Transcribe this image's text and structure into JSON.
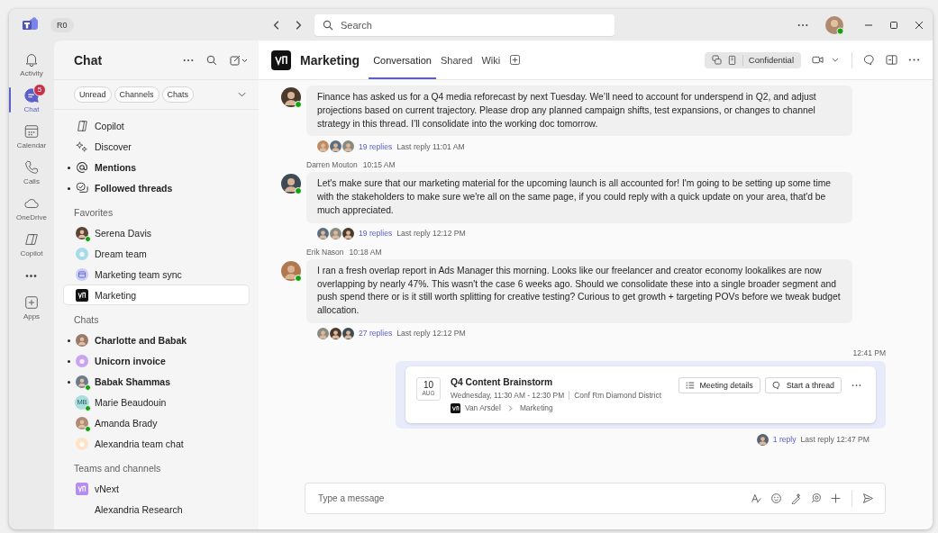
{
  "titlebar": {
    "account": "R0",
    "search": {
      "placeholder": "Search"
    }
  },
  "rail": [
    {
      "label": "Activity",
      "kind": "bell",
      "selected": false
    },
    {
      "label": "Chat",
      "kind": "chat",
      "selected": true,
      "badge": "5"
    },
    {
      "label": "Calendar",
      "kind": "calendar",
      "selected": false
    },
    {
      "label": "Calls",
      "kind": "phone",
      "selected": false
    },
    {
      "label": "OneDrive",
      "kind": "cloud",
      "selected": false
    },
    {
      "label": "Copilot",
      "kind": "copilot",
      "selected": false
    },
    {
      "label": "•••",
      "kind": "more",
      "selected": false
    },
    {
      "label": "Apps",
      "kind": "apps",
      "selected": false
    }
  ],
  "sidebar": {
    "title": "Chat",
    "filters": [
      "Unread",
      "Channels",
      "Chats"
    ],
    "sections": [
      {
        "items": [
          {
            "label": "Copilot",
            "kind": "copilot",
            "unread": false,
            "selected": false
          },
          {
            "label": "Discover",
            "kind": "discover",
            "unread": false,
            "selected": false
          },
          {
            "label": "Mentions",
            "kind": "mention",
            "unread": true,
            "selected": false
          },
          {
            "label": "Followed threads",
            "kind": "threads",
            "unread": true,
            "selected": false
          }
        ]
      },
      {
        "heading": "Favorites",
        "items": [
          {
            "label": "Serena Davis",
            "kind": "person",
            "color": "#5b4636",
            "online": true,
            "unread": false,
            "selected": false
          },
          {
            "label": "Dream team",
            "kind": "group",
            "color": "#a8dbe8",
            "unread": false,
            "selected": false
          },
          {
            "label": "Marketing team sync",
            "kind": "meeting",
            "color": "#c9cdf5",
            "unread": false,
            "selected": false
          },
          {
            "label": "Marketing",
            "kind": "team",
            "color": "#111111",
            "unread": false,
            "selected": true
          }
        ]
      },
      {
        "heading": "Chats",
        "items": [
          {
            "label": "Charlotte and Babak",
            "kind": "person",
            "color": "#9a7a66",
            "online": false,
            "unread": true,
            "selected": false
          },
          {
            "label": "Unicorn invoice",
            "kind": "group",
            "color": "#c9a3f0",
            "unread": true,
            "selected": false
          },
          {
            "label": "Babak Shammas",
            "kind": "person",
            "color": "#6b7b8a",
            "online": true,
            "unread": true,
            "selected": false
          },
          {
            "label": "Marie Beaudouin",
            "kind": "initials",
            "initials": "MB",
            "color": "#a9dede",
            "online": true,
            "unread": false,
            "selected": false
          },
          {
            "label": "Amanda Brady",
            "kind": "person",
            "color": "#b08c78",
            "online": true,
            "unread": false,
            "selected": false
          },
          {
            "label": "Alexandria team chat",
            "kind": "group",
            "color": "#fde3c8",
            "unread": false,
            "selected": false
          }
        ]
      },
      {
        "heading": "Teams and channels",
        "items": [
          {
            "label": "vNext",
            "kind": "team",
            "color": "#b58cf2",
            "unread": false,
            "selected": false
          },
          {
            "label": "Alexandria Research",
            "kind": "channel",
            "unread": false,
            "selected": false
          }
        ]
      }
    ]
  },
  "channel": {
    "name": "Marketing",
    "tabs": [
      {
        "label": "Conversation",
        "selected": true
      },
      {
        "label": "Shared",
        "selected": false
      },
      {
        "label": "Wiki",
        "selected": false
      }
    ],
    "sensitivity": "Confidential"
  },
  "messages": [
    {
      "online": true,
      "text": "Finance has asked us for a Q4 media reforecast by next Tuesday. We’ll need to account for underspend in Q2, and adjust projections based on current trajectory. Please drop any planned campaign shifts, test expansions, or changes to channel strategy in this thread. I’ll consolidate into the working doc tomorrow.",
      "replies": "19 replies",
      "last_reply": "Last reply 11:01 AM"
    },
    {
      "author": "Darren Mouton",
      "time": "10:15 AM",
      "online": true,
      "text": "Let's make sure that our marketing material for the upcoming launch is all accounted for! I'm going to be setting up some time with the stakeholders to make sure we're all on the same page, if you could reply with a quick update on your area, that'd be much appreciated.",
      "replies": "19 replies",
      "last_reply": "Last reply 12:12 PM"
    },
    {
      "author": "Erik Nason",
      "time": "10:18 AM",
      "online": true,
      "text": "I ran a fresh overlap report in Ads Manager this morning. Looks like our freelancer and creator economy lookalikes are now overlapping by nearly 47%. This wasn't the case 6 weeks ago. Should we consolidate these into a single broader segment and push spend there or is it still worth splitting for creative testing? Curious to get growth + targeting POVs before we tweak budget allocation.",
      "replies": "27 replies",
      "last_reply": "Last reply 12:12 PM"
    }
  ],
  "meeting": {
    "time": "12:41 PM",
    "day": "10",
    "month": "AUG",
    "title": "Q4 Content Brainstorm",
    "when": "Wednesday, 11:30 AM - 12:30 PM",
    "where": "Conf Rm Diamond District",
    "team": "Van Arsdel",
    "channel": "Marketing",
    "buttons": [
      {
        "label": "Meeting details",
        "kind": "list"
      },
      {
        "label": "Start a thread",
        "kind": "thread"
      }
    ],
    "replies": "1 reply",
    "last_reply": "Last reply 12:47 PM"
  },
  "compose": {
    "placeholder": "Type a message"
  }
}
